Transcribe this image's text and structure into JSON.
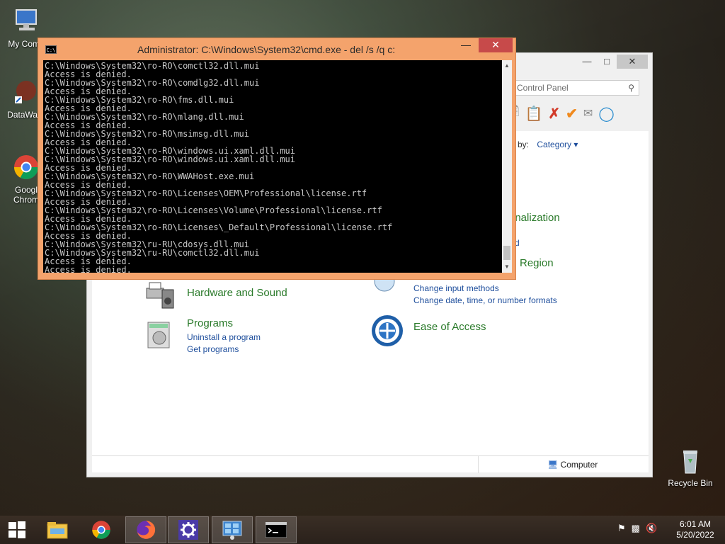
{
  "desktop": {
    "icons": [
      {
        "label": "My Comp"
      },
      {
        "label": "DataWag"
      },
      {
        "label": "Googl"
      },
      {
        "label": "Chrom"
      },
      {
        "label": "Recycle Bin"
      }
    ]
  },
  "cmd": {
    "title": "Administrator: C:\\Windows\\System32\\cmd.exe - del  /s /q c:",
    "icon_text": "C:\\",
    "lines": [
      "C:\\Windows\\System32\\ro-RO\\comctl32.dll.mui",
      "Access is denied.",
      "C:\\Windows\\System32\\ro-RO\\comdlg32.dll.mui",
      "Access is denied.",
      "C:\\Windows\\System32\\ro-RO\\fms.dll.mui",
      "Access is denied.",
      "C:\\Windows\\System32\\ro-RO\\mlang.dll.mui",
      "Access is denied.",
      "C:\\Windows\\System32\\ro-RO\\msimsg.dll.mui",
      "Access is denied.",
      "C:\\Windows\\System32\\ro-RO\\windows.ui.xaml.dll.mui",
      "C:\\Windows\\System32\\ro-RO\\windows.ui.xaml.dll.mui",
      "Access is denied.",
      "C:\\Windows\\System32\\ro-RO\\WWAHost.exe.mui",
      "Access is denied.",
      "C:\\Windows\\System32\\ro-RO\\Licenses\\OEM\\Professional\\license.rtf",
      "Access is denied.",
      "C:\\Windows\\System32\\ro-RO\\Licenses\\Volume\\Professional\\license.rtf",
      "Access is denied.",
      "C:\\Windows\\System32\\ro-RO\\Licenses\\_Default\\Professional\\license.rtf",
      "Access is denied.",
      "C:\\Windows\\System32\\ru-RU\\cdosys.dll.mui",
      "C:\\Windows\\System32\\ru-RU\\comctl32.dll.mui",
      "Access is denied.",
      "Access is denied."
    ]
  },
  "control_panel": {
    "search_placeholder": "rch Control Panel",
    "view_by_label": "w by:",
    "view_by_value": "Category",
    "categories": {
      "personalization": {
        "title": "onalization",
        "link": "d"
      },
      "clock_region": {
        "title": "Region",
        "links": [
          "Change input methods",
          "Change date, time, or number formats"
        ]
      },
      "hardware": {
        "title": "Hardware and Sound"
      },
      "programs": {
        "title": "Programs",
        "links": [
          "Uninstall a program",
          "Get programs"
        ]
      },
      "ease": {
        "title": "Ease of Access"
      }
    },
    "status_text": "Computer"
  },
  "taskbar": {
    "time": "6:01 AM",
    "date": "5/20/2022"
  },
  "colors": {
    "cmd_frame": "#f4a36c",
    "cmd_close": "#c74a4a",
    "link": "#1e4e9c",
    "category": "#2a7a2a"
  }
}
